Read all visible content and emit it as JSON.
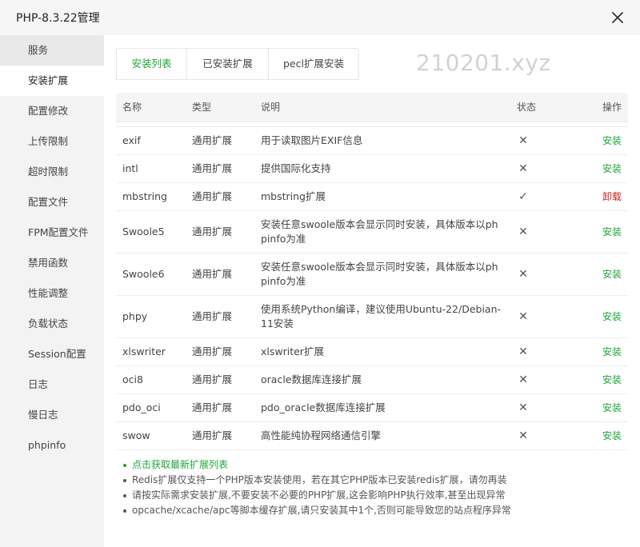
{
  "window": {
    "title": "PHP-8.3.22管理"
  },
  "sidebar": {
    "items": [
      {
        "label": "服务"
      },
      {
        "label": "安装扩展"
      },
      {
        "label": "配置修改"
      },
      {
        "label": "上传限制"
      },
      {
        "label": "超时限制"
      },
      {
        "label": "配置文件"
      },
      {
        "label": "FPM配置文件"
      },
      {
        "label": "禁用函数"
      },
      {
        "label": "性能调整"
      },
      {
        "label": "负载状态"
      },
      {
        "label": "Session配置"
      },
      {
        "label": "日志"
      },
      {
        "label": "慢日志"
      },
      {
        "label": "phpinfo"
      }
    ],
    "active_index": 1
  },
  "tabs": [
    {
      "label": "安装列表"
    },
    {
      "label": "已安装扩展"
    },
    {
      "label": "pecl扩展安装"
    }
  ],
  "watermark": "210201.xyz",
  "table": {
    "headers": {
      "name": "名称",
      "type": "类型",
      "desc": "说明",
      "status": "状态",
      "action": "操作"
    },
    "rows": [
      {
        "name": "exif",
        "type": "通用扩展",
        "desc": "用于读取图片EXIF信息",
        "status": "✕",
        "action": "安装"
      },
      {
        "name": "intl",
        "type": "通用扩展",
        "desc": "提供国际化支持",
        "status": "✕",
        "action": "安装"
      },
      {
        "name": "mbstring",
        "type": "通用扩展",
        "desc": "mbstring扩展",
        "status": "✓",
        "action": "卸载"
      },
      {
        "name": "Swoole5",
        "type": "通用扩展",
        "desc": "安装任意swoole版本会显示同时安装，具体版本以phpinfo为准",
        "status": "✕",
        "action": "安装"
      },
      {
        "name": "Swoole6",
        "type": "通用扩展",
        "desc": "安装任意swoole版本会显示同时安装，具体版本以phpinfo为准",
        "status": "✕",
        "action": "安装"
      },
      {
        "name": "phpy",
        "type": "通用扩展",
        "desc": "使用系统Python编译，建议使用Ubuntu-22/Debian-11安装",
        "status": "✕",
        "action": "安装"
      },
      {
        "name": "xlswriter",
        "type": "通用扩展",
        "desc": "xlswriter扩展",
        "status": "✕",
        "action": "安装"
      },
      {
        "name": "oci8",
        "type": "通用扩展",
        "desc": "oracle数据库连接扩展",
        "status": "✕",
        "action": "安装"
      },
      {
        "name": "pdo_oci",
        "type": "通用扩展",
        "desc": "pdo_oracle数据库连接扩展",
        "status": "✕",
        "action": "安装"
      },
      {
        "name": "swow",
        "type": "通用扩展",
        "desc": "高性能纯协程网络通信引擎",
        "status": "✕",
        "action": "安装"
      }
    ]
  },
  "notes": [
    "点击获取最新扩展列表",
    "Redis扩展仅支持一个PHP版本安装使用，若在其它PHP版本已安装redis扩展，请勿再装",
    "请按实际需求安装扩展,不要安装不必要的PHP扩展,这会影响PHP执行效率,甚至出现异常",
    "opcache/xcache/apc等脚本缓存扩展,请只安装其中1个,否则可能导致您的站点程序异常"
  ],
  "colors": {
    "accent": "#20a53a",
    "danger": "#cc1e1e"
  }
}
